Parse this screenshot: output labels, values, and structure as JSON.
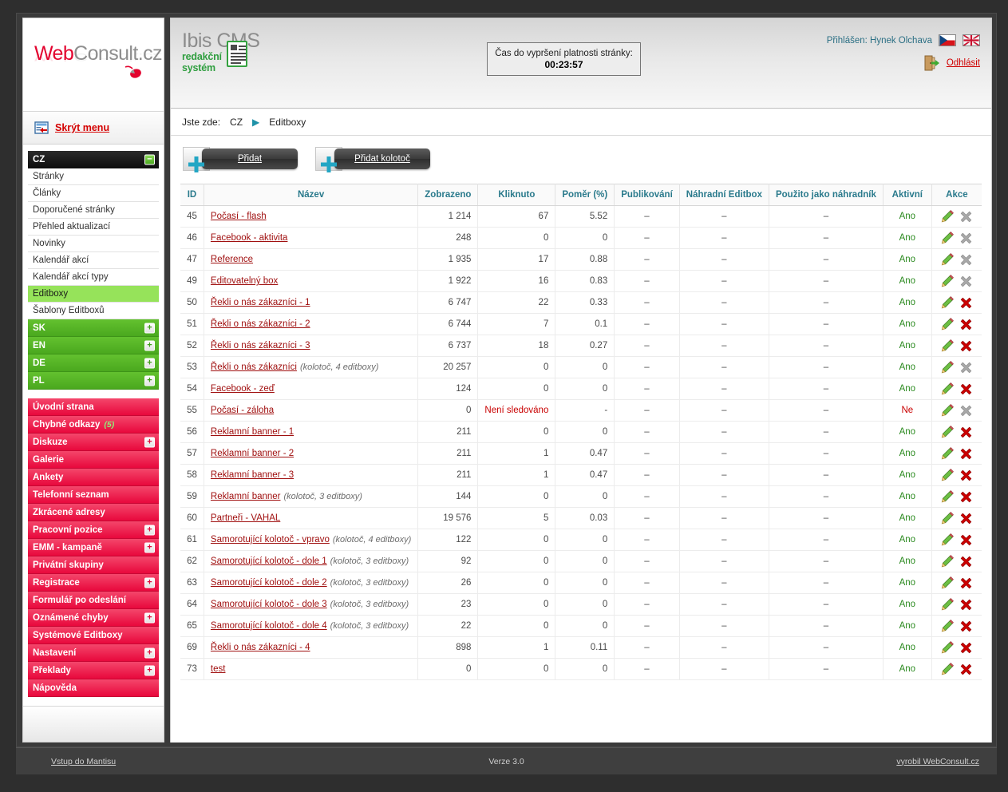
{
  "brand": {
    "logo_web": "Web",
    "logo_consult": "Consult",
    "logo_cz": ".cz",
    "cms_title": "Ibis CMS",
    "cms_sub_line1": "redakční",
    "cms_sub_line2": "systém"
  },
  "sidebar": {
    "hide_menu_label": "Skrýt menu",
    "cz_group": {
      "header": "CZ",
      "toggle": "−",
      "items": [
        {
          "label": "Stránky",
          "active": false
        },
        {
          "label": "Články",
          "active": false
        },
        {
          "label": "Doporučené stránky",
          "active": false
        },
        {
          "label": "Přehled aktualizací",
          "active": false
        },
        {
          "label": "Novinky",
          "active": false
        },
        {
          "label": "Kalendář akcí",
          "active": false
        },
        {
          "label": "Kalendář akcí typy",
          "active": false
        },
        {
          "label": "Editboxy",
          "active": true
        },
        {
          "label": "Šablony Editboxů",
          "active": false
        }
      ]
    },
    "lang_groups": [
      {
        "label": "SK",
        "toggle": "+"
      },
      {
        "label": "EN",
        "toggle": "+"
      },
      {
        "label": "DE",
        "toggle": "+"
      },
      {
        "label": "PL",
        "toggle": "+"
      }
    ],
    "red_items": [
      {
        "label": "Úvodní strana",
        "count": "",
        "toggle": ""
      },
      {
        "label": "Chybné odkazy",
        "count": "(5)",
        "toggle": ""
      },
      {
        "label": "Diskuze",
        "count": "",
        "toggle": "+"
      },
      {
        "label": "Galerie",
        "count": "",
        "toggle": ""
      },
      {
        "label": "Ankety",
        "count": "",
        "toggle": ""
      },
      {
        "label": "Telefonní seznam",
        "count": "",
        "toggle": ""
      },
      {
        "label": "Zkrácené adresy",
        "count": "",
        "toggle": ""
      },
      {
        "label": "Pracovní pozice",
        "count": "",
        "toggle": "+"
      },
      {
        "label": "EMM - kampaně",
        "count": "",
        "toggle": "+"
      },
      {
        "label": "Privátní skupiny",
        "count": "",
        "toggle": ""
      },
      {
        "label": "Registrace",
        "count": "",
        "toggle": "+"
      },
      {
        "label": "Formulář po odeslání",
        "count": "",
        "toggle": ""
      },
      {
        "label": "Oznámené chyby",
        "count": "",
        "toggle": "+"
      },
      {
        "label": "Systémové Editboxy",
        "count": "",
        "toggle": ""
      },
      {
        "label": "Nastavení",
        "count": "",
        "toggle": "+"
      },
      {
        "label": "Překlady",
        "count": "",
        "toggle": "+"
      },
      {
        "label": "Nápověda",
        "count": "",
        "toggle": ""
      }
    ]
  },
  "header": {
    "timer_label": "Čas do vypršení platnosti stránky:",
    "timer_value": "00:23:57",
    "logged_in": "Přihlášen: Hynek Olchava",
    "logout_label": "Odhlásit",
    "flags": [
      "cz-flag-icon",
      "en-flag-icon"
    ]
  },
  "breadcrumb": {
    "prefix": "Jste zde:",
    "root": "CZ",
    "arrow": "▶",
    "current": "Editboxy"
  },
  "toolbar": {
    "add_label": "Přidat",
    "add_carousel_label": "Přidat kolotoč"
  },
  "table": {
    "columns": [
      "ID",
      "Název",
      "Zobrazeno",
      "Kliknuto",
      "Poměr (%)",
      "Publikování",
      "Náhradní Editbox",
      "Použito jako náhradník",
      "Aktivní",
      "Akce"
    ],
    "rows": [
      {
        "id": "45",
        "name": "Počasí - flash",
        "note": "",
        "shown": "1 214",
        "clicked": "67",
        "ratio": "5.52",
        "publish": "–",
        "backup": "–",
        "used_as": "–",
        "active": "Ano",
        "active_state": "yes",
        "delete_enabled": false
      },
      {
        "id": "46",
        "name": "Facebook - aktivita",
        "note": "",
        "shown": "248",
        "clicked": "0",
        "ratio": "0",
        "publish": "–",
        "backup": "–",
        "used_as": "–",
        "active": "Ano",
        "active_state": "yes",
        "delete_enabled": false
      },
      {
        "id": "47",
        "name": "Reference",
        "note": "",
        "shown": "1 935",
        "clicked": "17",
        "ratio": "0.88",
        "publish": "–",
        "backup": "–",
        "used_as": "–",
        "active": "Ano",
        "active_state": "yes",
        "delete_enabled": false
      },
      {
        "id": "49",
        "name": "Editovatelný box",
        "note": "",
        "shown": "1 922",
        "clicked": "16",
        "ratio": "0.83",
        "publish": "–",
        "backup": "–",
        "used_as": "–",
        "active": "Ano",
        "active_state": "yes",
        "delete_enabled": false
      },
      {
        "id": "50",
        "name": "Řekli o nás zákazníci - 1",
        "note": "",
        "shown": "6 747",
        "clicked": "22",
        "ratio": "0.33",
        "publish": "–",
        "backup": "–",
        "used_as": "–",
        "active": "Ano",
        "active_state": "yes",
        "delete_enabled": true
      },
      {
        "id": "51",
        "name": "Řekli o nás zákazníci - 2",
        "note": "",
        "shown": "6 744",
        "clicked": "7",
        "ratio": "0.1",
        "publish": "–",
        "backup": "–",
        "used_as": "–",
        "active": "Ano",
        "active_state": "yes",
        "delete_enabled": true
      },
      {
        "id": "52",
        "name": "Řekli o nás zákazníci - 3",
        "note": "",
        "shown": "6 737",
        "clicked": "18",
        "ratio": "0.27",
        "publish": "–",
        "backup": "–",
        "used_as": "–",
        "active": "Ano",
        "active_state": "yes",
        "delete_enabled": true
      },
      {
        "id": "53",
        "name": "Řekli o nás zákazníci",
        "note": "(kolotoč,  4 editboxy)",
        "shown": "20 257",
        "clicked": "0",
        "ratio": "0",
        "publish": "–",
        "backup": "–",
        "used_as": "–",
        "active": "Ano",
        "active_state": "yes",
        "delete_enabled": false
      },
      {
        "id": "54",
        "name": "Facebook - zeď",
        "note": "",
        "shown": "124",
        "clicked": "0",
        "ratio": "0",
        "publish": "–",
        "backup": "–",
        "used_as": "–",
        "active": "Ano",
        "active_state": "yes",
        "delete_enabled": true
      },
      {
        "id": "55",
        "name": "Počasí - záloha",
        "note": "",
        "shown": "0",
        "clicked": "Není sledováno",
        "clicked_state": "nt",
        "ratio": "-",
        "publish": "–",
        "backup": "–",
        "used_as": "–",
        "active": "Ne",
        "active_state": "no",
        "delete_enabled": false
      },
      {
        "id": "56",
        "name": "Reklamní banner - 1",
        "note": "",
        "shown": "211",
        "clicked": "0",
        "ratio": "0",
        "publish": "–",
        "backup": "–",
        "used_as": "–",
        "active": "Ano",
        "active_state": "yes",
        "delete_enabled": true
      },
      {
        "id": "57",
        "name": "Reklamní banner - 2",
        "note": "",
        "shown": "211",
        "clicked": "1",
        "ratio": "0.47",
        "publish": "–",
        "backup": "–",
        "used_as": "–",
        "active": "Ano",
        "active_state": "yes",
        "delete_enabled": true
      },
      {
        "id": "58",
        "name": "Reklamní banner - 3",
        "note": "",
        "shown": "211",
        "clicked": "1",
        "ratio": "0.47",
        "publish": "–",
        "backup": "–",
        "used_as": "–",
        "active": "Ano",
        "active_state": "yes",
        "delete_enabled": true
      },
      {
        "id": "59",
        "name": "Reklamní banner",
        "note": "(kolotoč,  3 editboxy)",
        "shown": "144",
        "clicked": "0",
        "ratio": "0",
        "publish": "–",
        "backup": "–",
        "used_as": "–",
        "active": "Ano",
        "active_state": "yes",
        "delete_enabled": true
      },
      {
        "id": "60",
        "name": "Partneři - VAHAL",
        "note": "",
        "shown": "19 576",
        "clicked": "5",
        "ratio": "0.03",
        "publish": "–",
        "backup": "–",
        "used_as": "–",
        "active": "Ano",
        "active_state": "yes",
        "delete_enabled": true
      },
      {
        "id": "61",
        "name": "Samorotující kolotoč - vpravo",
        "note": "(kolotoč,  4 editboxy)",
        "shown": "122",
        "clicked": "0",
        "ratio": "0",
        "publish": "–",
        "backup": "–",
        "used_as": "–",
        "active": "Ano",
        "active_state": "yes",
        "delete_enabled": true
      },
      {
        "id": "62",
        "name": "Samorotující kolotoč - dole 1",
        "note": "(kolotoč,  3 editboxy)",
        "shown": "92",
        "clicked": "0",
        "ratio": "0",
        "publish": "–",
        "backup": "–",
        "used_as": "–",
        "active": "Ano",
        "active_state": "yes",
        "delete_enabled": true
      },
      {
        "id": "63",
        "name": "Samorotující kolotoč - dole 2",
        "note": "(kolotoč,  3 editboxy)",
        "shown": "26",
        "clicked": "0",
        "ratio": "0",
        "publish": "–",
        "backup": "–",
        "used_as": "–",
        "active": "Ano",
        "active_state": "yes",
        "delete_enabled": true
      },
      {
        "id": "64",
        "name": "Samorotující kolotoč - dole 3",
        "note": "(kolotoč,  3 editboxy)",
        "shown": "23",
        "clicked": "0",
        "ratio": "0",
        "publish": "–",
        "backup": "–",
        "used_as": "–",
        "active": "Ano",
        "active_state": "yes",
        "delete_enabled": true
      },
      {
        "id": "65",
        "name": "Samorotující kolotoč - dole 4",
        "note": "(kolotoč,  3 editboxy)",
        "shown": "22",
        "clicked": "0",
        "ratio": "0",
        "publish": "–",
        "backup": "–",
        "used_as": "–",
        "active": "Ano",
        "active_state": "yes",
        "delete_enabled": true
      },
      {
        "id": "69",
        "name": "Řekli o nás zákazníci - 4",
        "note": "",
        "shown": "898",
        "clicked": "1",
        "ratio": "0.11",
        "publish": "–",
        "backup": "–",
        "used_as": "–",
        "active": "Ano",
        "active_state": "yes",
        "delete_enabled": true
      },
      {
        "id": "73",
        "name": "test",
        "note": "",
        "shown": "0",
        "clicked": "0",
        "ratio": "0",
        "publish": "–",
        "backup": "–",
        "used_as": "–",
        "active": "Ano",
        "active_state": "yes",
        "delete_enabled": true
      }
    ]
  },
  "footer": {
    "left_link": "Vstup do Mantisu",
    "version": "Verze 3.0",
    "right_link": "vyrobil WebConsult.cz"
  },
  "colors": {
    "accent_red": "#e3032e",
    "accent_green": "#4aa81e",
    "header_teal": "#2a7a8c",
    "link_red": "#a01010"
  }
}
